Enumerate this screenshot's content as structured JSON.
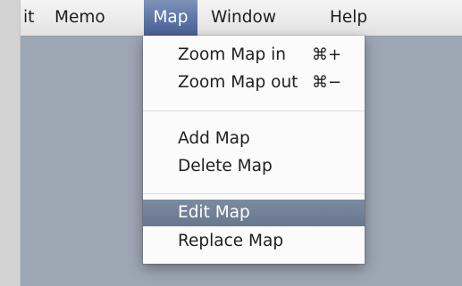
{
  "menubar": {
    "items": [
      {
        "label": "it"
      },
      {
        "label": "Memo"
      },
      {
        "label": "Map"
      },
      {
        "label": "Window"
      },
      {
        "label": "Help"
      }
    ],
    "active_index": 2
  },
  "map_menu": {
    "items": [
      {
        "label": "Zoom Map in",
        "shortcut": "⌘+"
      },
      {
        "label": "Zoom Map out",
        "shortcut": "⌘−"
      },
      {
        "label": "Add Map"
      },
      {
        "label": "Delete Map"
      },
      {
        "label": "Edit Map",
        "highlighted": true
      },
      {
        "label": "Replace Map"
      }
    ]
  },
  "colors": {
    "desktop": "#9da6b3",
    "menu_highlight": "#5d76a6",
    "item_highlight": "#6f7d94"
  }
}
